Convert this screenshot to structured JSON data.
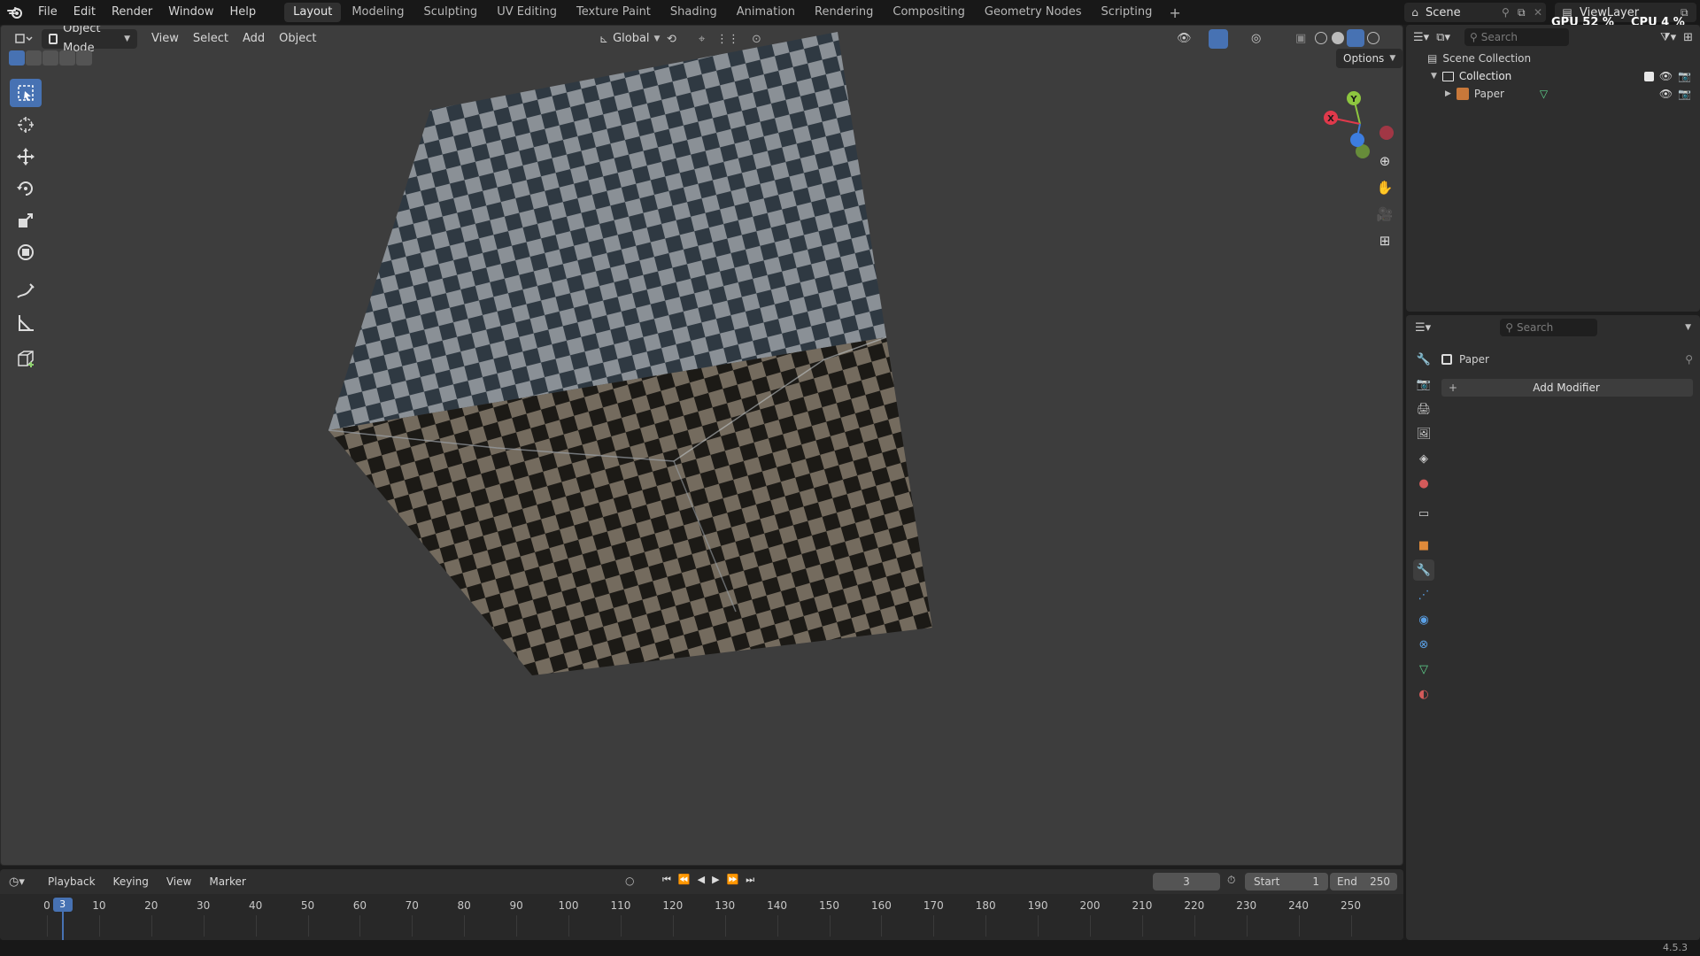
{
  "menu": [
    "File",
    "Edit",
    "Render",
    "Window",
    "Help"
  ],
  "workspaces": [
    "Layout",
    "Modeling",
    "Sculpting",
    "UV Editing",
    "Texture Paint",
    "Shading",
    "Animation",
    "Rendering",
    "Compositing",
    "Geometry Nodes",
    "Scripting"
  ],
  "active_workspace": "Layout",
  "scene_name": "Scene",
  "view_layer_name": "ViewLayer",
  "gpu_label": "GPU",
  "gpu_value": "52 %",
  "cpu_label": "CPU",
  "cpu_value": "4 %",
  "viewport": {
    "mode": "Object Mode",
    "menus": [
      "View",
      "Select",
      "Add",
      "Object"
    ],
    "transform_orientation": "Global",
    "options_label": "Options"
  },
  "outliner": {
    "search_placeholder": "Search",
    "scene_collection": "Scene Collection",
    "collection": "Collection",
    "object": "Paper"
  },
  "properties": {
    "search_placeholder": "Search",
    "object_name": "Paper",
    "add_modifier": "Add Modifier"
  },
  "timeline": {
    "menus": [
      "Playback",
      "Keying",
      "View",
      "Marker"
    ],
    "current_frame": "3",
    "start_label": "Start",
    "start_value": "1",
    "end_label": "End",
    "end_value": "250",
    "ticks": [
      "0",
      "10",
      "20",
      "30",
      "40",
      "50",
      "60",
      "70",
      "80",
      "90",
      "100",
      "110",
      "120",
      "130",
      "140",
      "150",
      "160",
      "170",
      "180",
      "190",
      "200",
      "210",
      "220",
      "230",
      "240",
      "250"
    ],
    "playhead_label": "3"
  },
  "version": "4.5.3",
  "colors": {
    "accent": "#4772b3",
    "viewport_bg": "#3d3d3d",
    "panel_bg": "#2e2e2e"
  }
}
